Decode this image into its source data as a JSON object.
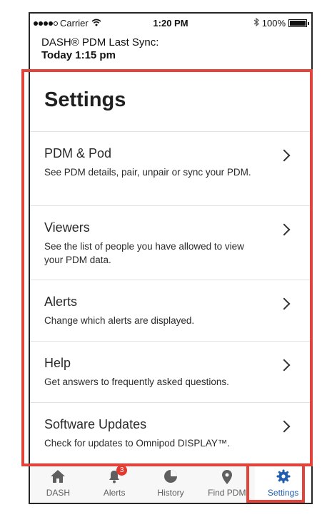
{
  "status_bar": {
    "carrier": "Carrier",
    "time": "1:20 PM",
    "battery": "100%",
    "battery_level_percent": 100
  },
  "sync": {
    "line1": "DASH® PDM Last Sync:",
    "line2": "Today 1:15 pm"
  },
  "page": {
    "title": "Settings"
  },
  "menu": [
    {
      "label": "PDM & Pod",
      "description": "See PDM details, pair, unpair or sync your PDM."
    },
    {
      "label": "Viewers",
      "description": "See the list of people you have allowed to view your PDM data."
    },
    {
      "label": "Alerts",
      "description": "Change which alerts are displayed."
    },
    {
      "label": "Help",
      "description": "Get answers to frequently asked questions."
    },
    {
      "label": "Software Updates",
      "description": "Check for updates to Omnipod DISPLAY™."
    }
  ],
  "tabs": [
    {
      "label": "DASH",
      "icon": "home-icon"
    },
    {
      "label": "Alerts",
      "icon": "bell-icon",
      "badge": "3"
    },
    {
      "label": "History",
      "icon": "pie-chart-icon"
    },
    {
      "label": "Find PDM",
      "icon": "location-pin-icon"
    },
    {
      "label": "Settings",
      "icon": "gear-icon",
      "active": true
    }
  ],
  "colors": {
    "accent": "#1f5fae",
    "tab_inactive": "#5f5f5f",
    "badge": "#e3382e",
    "highlight": "#e0443a"
  }
}
